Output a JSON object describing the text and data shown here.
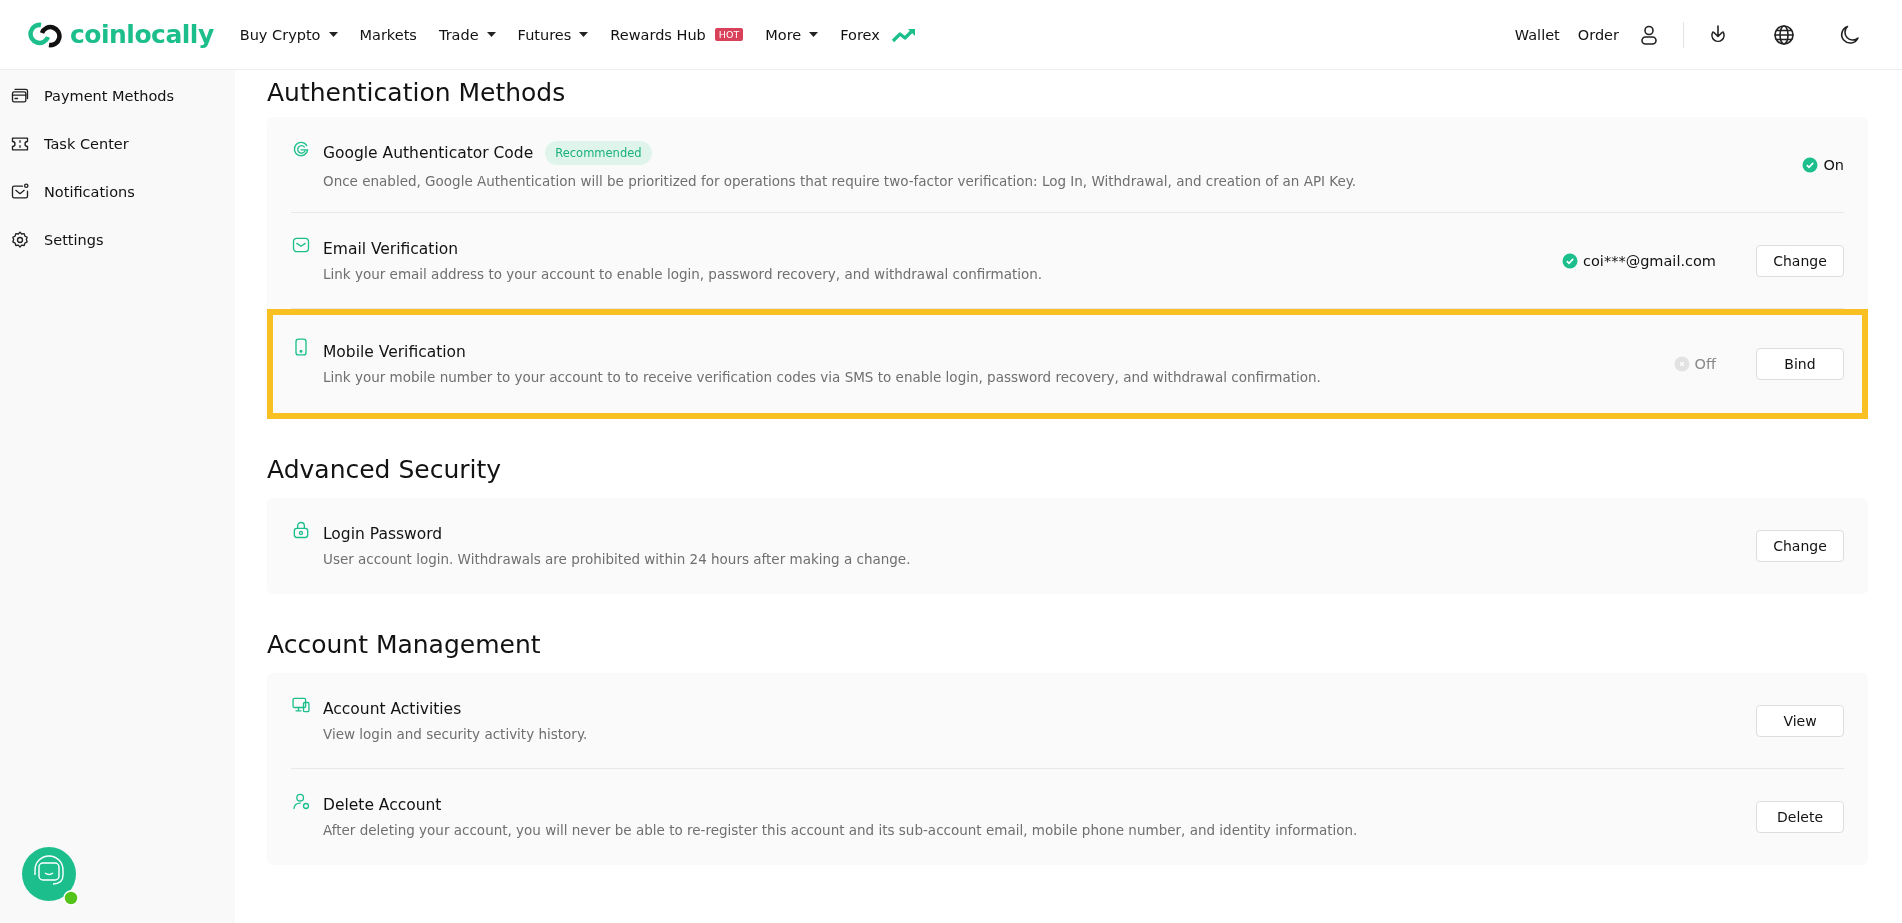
{
  "logo": {
    "text": "coinlocally"
  },
  "nav": [
    {
      "label": "Buy Crypto",
      "dropdown": true
    },
    {
      "label": "Markets",
      "dropdown": false
    },
    {
      "label": "Trade",
      "dropdown": true
    },
    {
      "label": "Futures",
      "dropdown": true
    },
    {
      "label": "Rewards Hub",
      "dropdown": false,
      "badge": "HOT"
    },
    {
      "label": "More",
      "dropdown": true
    },
    {
      "label": "Forex",
      "dropdown": false
    }
  ],
  "header_links": [
    "Wallet",
    "Order"
  ],
  "sidebar": {
    "items": [
      {
        "label": "Payment Methods"
      },
      {
        "label": "Task Center"
      },
      {
        "label": "Notifications"
      },
      {
        "label": "Settings"
      }
    ]
  },
  "sections": [
    {
      "title": "Authentication Methods",
      "items": [
        {
          "title": "Google Authenticator Code",
          "badge": "Recommended",
          "description": "Once enabled, Google Authentication will be prioritized for operations that require two-factor verification: Log In, Withdrawal, and creation of an API Key.",
          "status": {
            "text": "On",
            "on": true
          },
          "highlighted": false
        },
        {
          "title": "Email Verification",
          "description": "Link your email address to your account to enable login, password recovery, and withdrawal confirmation.",
          "status": {
            "text": "coi***@gmail.com",
            "on": true
          },
          "button": "Change",
          "highlighted": false
        },
        {
          "title": "Mobile Verification",
          "description": "Link your mobile number to your account to to receive verification codes via SMS to enable login, password recovery, and withdrawal confirmation.",
          "status": {
            "text": "Off",
            "on": false
          },
          "button": "Bind",
          "highlighted": true
        }
      ]
    },
    {
      "title": "Advanced Security",
      "items": [
        {
          "title": "Login Password",
          "description": "User account login. Withdrawals are prohibited within 24 hours after making a change.",
          "button": "Change",
          "highlighted": false
        }
      ]
    },
    {
      "title": "Account Management",
      "items": [
        {
          "title": "Account Activities",
          "description": "View login and security activity history.",
          "button": "View",
          "highlighted": false
        },
        {
          "title": "Delete Account",
          "description": "After deleting your account, you will never be able to re-register this account and its sub-account email, mobile phone number, and identity information.",
          "button": "Delete",
          "highlighted": false
        }
      ]
    }
  ]
}
